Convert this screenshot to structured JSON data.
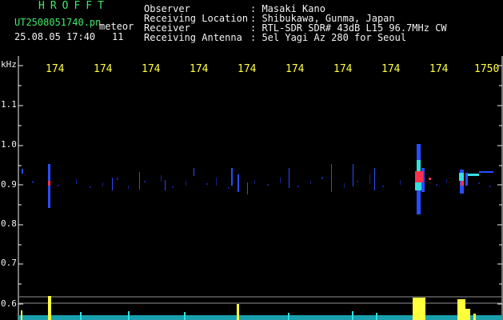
{
  "header": {
    "brand": "HROFFT",
    "filename": "UT2508051740.pn",
    "tag": "meteor",
    "datetime": "25.08.05 17:40",
    "count": "11",
    "info": [
      {
        "label": "Observer",
        "value": ": Masaki Kano"
      },
      {
        "label": "Receiving Location",
        "value": ": Shibukawa, Gunma, Japan"
      },
      {
        "label": "Receiver",
        "value": ": RTL-SDR SDR# 43dB L15 96.7MHz CW"
      },
      {
        "label": "Receiving Antenna",
        "value": ": 5el Yagi Az 280 for Seoul"
      }
    ]
  },
  "axis": {
    "unit": "kHz",
    "y_ticks": [
      "1.1",
      "1.0",
      "0.9",
      "0.8",
      "0.7",
      "0.6"
    ],
    "x_ticks": [
      "174",
      "174",
      "174",
      "174",
      "174",
      "174",
      "174",
      "174",
      "174",
      "1750"
    ]
  },
  "colors": {
    "header_green": "#3fe96b",
    "text_white": "#f2f2f2",
    "tick_yellow": "#ffff3c",
    "signal_blue": "#2a4cff",
    "signal_red": "#ff3050",
    "signal_cyan": "#33e0e0"
  }
}
